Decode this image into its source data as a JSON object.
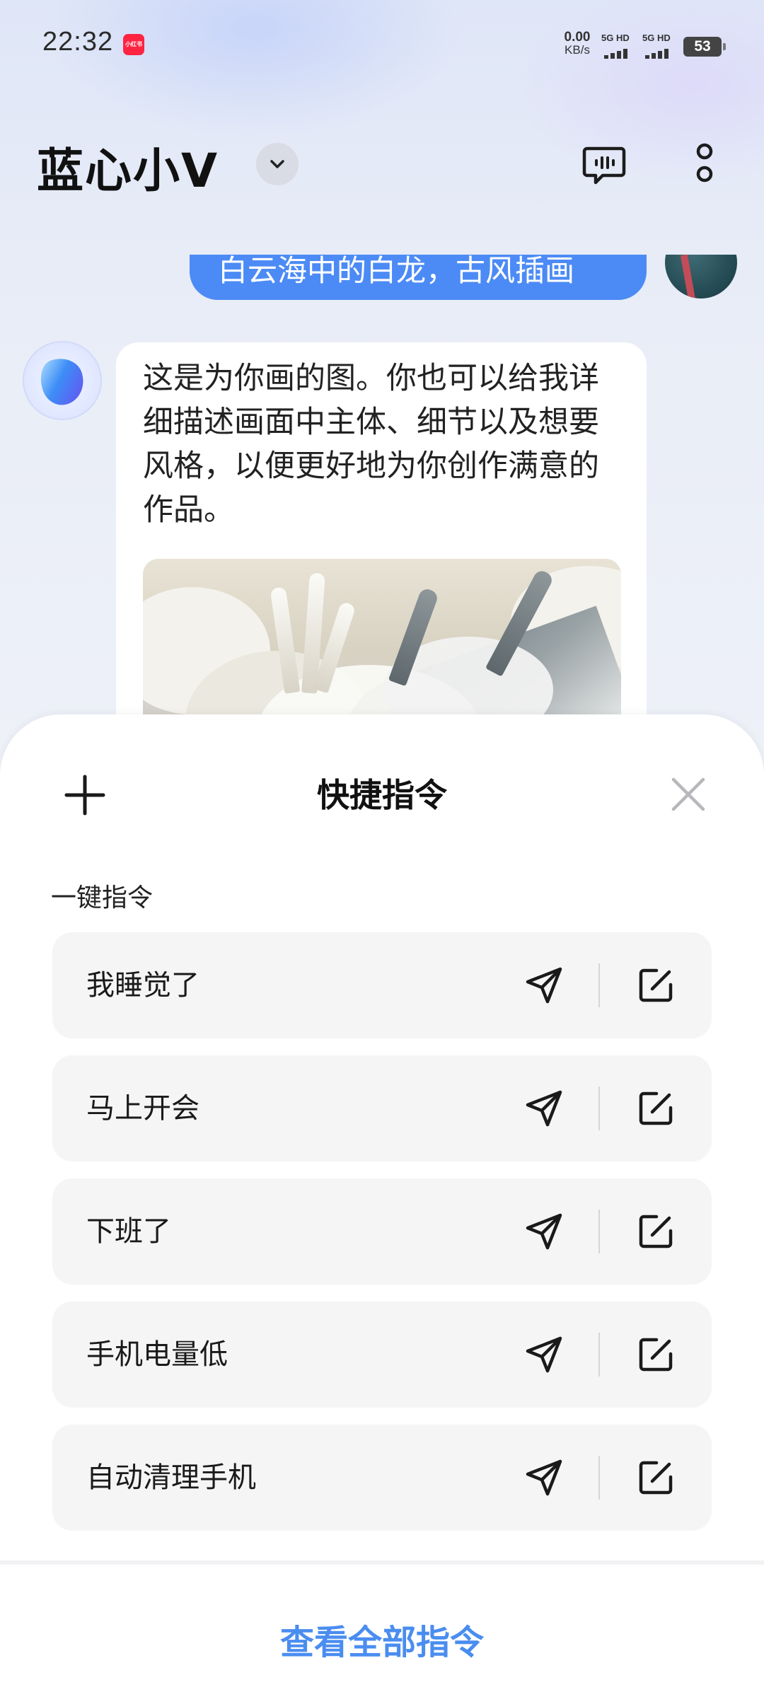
{
  "status_bar": {
    "time": "22:32",
    "app_badge": "小红书",
    "net_speed_value": "0.00",
    "net_speed_unit": "KB/s",
    "sim1_label": "5G HD",
    "sim2_label": "5G HD",
    "battery": "53"
  },
  "header": {
    "title": "蓝心小V"
  },
  "chat": {
    "user_message_partial": "白云海中的白龙，古风插画",
    "bot_message": "这是为你画的图。你也可以给我详细描述画面中主体、细节以及想要风格，以便更好地为你创作满意的作品。"
  },
  "sheet": {
    "title": "快捷指令",
    "section_label": "一键指令",
    "commands": [
      {
        "label": "我睡觉了"
      },
      {
        "label": "马上开会"
      },
      {
        "label": "下班了"
      },
      {
        "label": "手机电量低"
      },
      {
        "label": "自动清理手机"
      }
    ],
    "view_all": "查看全部指令"
  },
  "colors": {
    "accent": "#4a8df0",
    "user_bubble": "#4c8bf5",
    "command_bg": "#f5f5f6"
  },
  "icons": {
    "add": "plus-icon",
    "close": "close-icon",
    "send": "send-icon",
    "edit": "edit-icon",
    "dropdown": "chevron-down-icon",
    "chat": "chat-bubble-icon",
    "more": "more-vertical-icon"
  }
}
